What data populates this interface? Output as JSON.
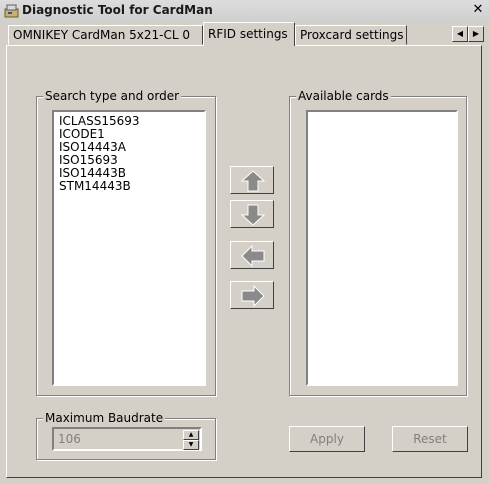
{
  "window": {
    "title": "Diagnostic Tool for CardMan",
    "close_glyph": "✕"
  },
  "tabs": [
    {
      "label": "OMNIKEY CardMan 5x21-CL 0",
      "selected": false
    },
    {
      "label": "RFID settings",
      "selected": true
    },
    {
      "label": "Proxcard settings",
      "selected": false
    }
  ],
  "tab_scroll": {
    "left_glyph": "◀",
    "right_glyph": "▶"
  },
  "search_group": {
    "label": "Search type and order",
    "items": [
      "ICLASS15693",
      "ICODE1",
      "ISO14443A",
      "ISO15693",
      "ISO14443B",
      "STM14443B"
    ]
  },
  "available_group": {
    "label": "Available cards",
    "items": []
  },
  "arrow_buttons": [
    {
      "name": "move-up",
      "icon": "arrow-up-icon"
    },
    {
      "name": "move-down",
      "icon": "arrow-down-icon"
    },
    {
      "name": "move-left",
      "icon": "arrow-left-icon"
    },
    {
      "name": "move-right",
      "icon": "arrow-right-icon"
    }
  ],
  "baudrate_group": {
    "label": "Maximum Baudrate",
    "value": "106",
    "up_glyph": "▲",
    "down_glyph": "▼"
  },
  "buttons": {
    "apply_label": "Apply",
    "reset_label": "Reset"
  },
  "colors": {
    "face": "#d4d0c8",
    "shadow": "#808080",
    "dark": "#404040",
    "arrow_fill": "#8a8a8a"
  }
}
